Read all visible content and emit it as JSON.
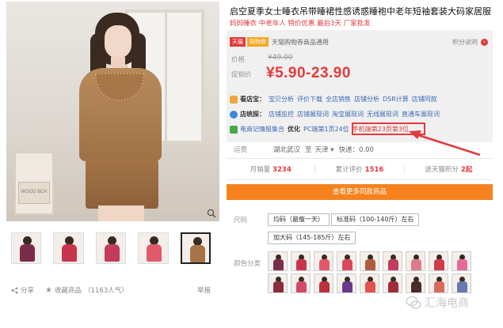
{
  "product": {
    "title": "启空夏季女士睡衣吊带睡裙性感诱惑睡袍中老年短袖套装大码家居服",
    "subtitle": "妈妈睡衣 中老年人 特价优惠 最后3天 厂家批发"
  },
  "gallery": {
    "box_text": "WOOD BOX",
    "thumb_colors": [
      "#7a2d4a",
      "#c8344c",
      "#c23c5c",
      "#e05a6a",
      "#a77348"
    ],
    "share_label": "分享",
    "fav_label": "收藏商品",
    "fav_count": "（1163人气）",
    "report_label": "举报"
  },
  "promo": {
    "tmall_badge": "天猫",
    "shop_badge": "购物券",
    "tmall_text": "天猫购物券商品通用",
    "points_label": "积分说明",
    "points_icon": "›",
    "price_label": "价格",
    "old_price": "¥49.00",
    "promo_label": "促销价",
    "new_price": "¥5.90-23.90",
    "row1_label": "看店宝：",
    "row1_links": [
      "宝贝分析",
      "评价下载",
      "全店销售",
      "店铺分析",
      "DSR计算",
      "店铺同款"
    ],
    "row2_label": "店统探：",
    "row2_links": [
      "店铺监控",
      "店铺展现词",
      "淘宝展现词",
      "无线展现词",
      "直通车展现词"
    ],
    "row3_label": "电商记情报集合",
    "row3_opt": "优化",
    "row3_pc": "PC端第1页24位",
    "row3_mobile": "手机端第23页第3位"
  },
  "shipping": {
    "label": "运费",
    "from": "湖北武汉",
    "to_word": "至",
    "to": "天津",
    "express": "快递：0.00"
  },
  "stats": [
    {
      "label": "月销量",
      "value": "3234"
    },
    {
      "label": "累计评价",
      "value": "1516"
    },
    {
      "label": "送天猫积分",
      "value": "2起"
    }
  ],
  "buy_bar": "查看更多同款商品",
  "sizes": {
    "label": "尺码",
    "options": [
      "均码（最瘦一天）",
      "标准码（100-140斤）左右",
      "加大码（145-185斤）左右"
    ]
  },
  "colors": {
    "label": "颜色分类",
    "swatches": [
      "#7a2d4a",
      "#c8344c",
      "#e05a6a",
      "#d9485c",
      "#b05a3c",
      "#c23c5c",
      "#e07a8a",
      "#cf3c4c",
      "#e36a9a",
      "#8a2c3a",
      "#d04a6a",
      "#b8343c",
      "#6a3a8a",
      "#e4524a",
      "#a32c3a",
      "#4a2a2a",
      "#d86a5a",
      "#6a7ab0"
    ]
  },
  "watermark": "汇海电商",
  "icons": {
    "zoom": "zoom-icon",
    "share": "share-icon",
    "star": "star-icon",
    "arrow": "annotation-arrow",
    "watermark_logo": "wechat-logo-icon"
  },
  "accent": "#e4393c",
  "buy_bar_color": "#f6821f"
}
